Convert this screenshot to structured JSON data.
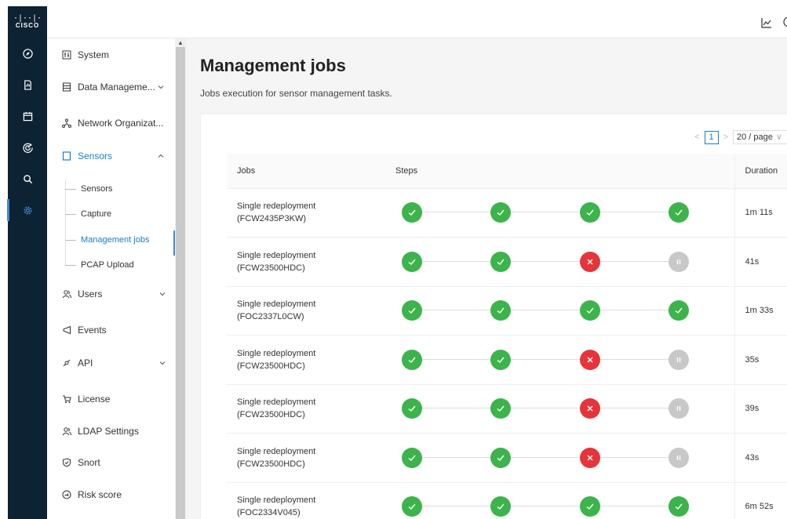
{
  "brand": {
    "logo_text": "CISCO",
    "logo_bars": "·|··|·"
  },
  "rail": [
    "compass-icon",
    "report-icon",
    "calendar-icon",
    "radar-icon",
    "search-icon",
    "gear-icon"
  ],
  "sidebar": {
    "items": [
      {
        "label": "System",
        "icon": "system-icon"
      },
      {
        "label": "Data Manageme...",
        "icon": "database-icon"
      },
      {
        "label": "Network Organizat...",
        "icon": "network-icon"
      },
      {
        "label": "Sensors",
        "icon": "sensor-icon"
      },
      {
        "label": "Users",
        "icon": "users-icon"
      },
      {
        "label": "Events",
        "icon": "events-icon"
      },
      {
        "label": "API",
        "icon": "api-icon"
      },
      {
        "label": "License",
        "icon": "license-icon"
      },
      {
        "label": "LDAP Settings",
        "icon": "ldap-icon"
      },
      {
        "label": "Snort",
        "icon": "snort-icon"
      },
      {
        "label": "Risk score",
        "icon": "risk-icon"
      }
    ],
    "sensors_sub": [
      {
        "label": "Sensors"
      },
      {
        "label": "Capture"
      },
      {
        "label": "Management jobs"
      },
      {
        "label": "PCAP Upload"
      }
    ]
  },
  "page": {
    "title": "Management jobs",
    "subtitle": "Jobs execution for sensor management tasks."
  },
  "pager": {
    "prev": "<",
    "page": "1",
    "next": ">",
    "size": "20 / page",
    "size_chevron": "∨"
  },
  "table": {
    "headers": {
      "jobs": "Jobs",
      "steps": "Steps",
      "duration": "Duration"
    },
    "rows": [
      {
        "job": "Single redeployment",
        "sensor": "(FCW2435P3KW)",
        "steps": [
          "done",
          "done",
          "done",
          "done"
        ],
        "duration": "1m 11s"
      },
      {
        "job": "Single redeployment",
        "sensor": "(FCW23500HDC)",
        "steps": [
          "done",
          "done",
          "fail",
          "pause"
        ],
        "duration": "41s"
      },
      {
        "job": "Single redeployment",
        "sensor": "(FOC2337L0CW)",
        "steps": [
          "done",
          "done",
          "done",
          "done"
        ],
        "duration": "1m 33s"
      },
      {
        "job": "Single redeployment",
        "sensor": "(FCW23500HDC)",
        "steps": [
          "done",
          "done",
          "fail",
          "pause"
        ],
        "duration": "35s"
      },
      {
        "job": "Single redeployment",
        "sensor": "(FCW23500HDC)",
        "steps": [
          "done",
          "done",
          "fail",
          "pause"
        ],
        "duration": "39s"
      },
      {
        "job": "Single redeployment",
        "sensor": "(FCW23500HDC)",
        "steps": [
          "done",
          "done",
          "fail",
          "pause"
        ],
        "duration": "43s"
      },
      {
        "job": "Single redeployment",
        "sensor": "(FOC2334V045)",
        "steps": [
          "done",
          "done",
          "done",
          "done"
        ],
        "duration": "6m 52s"
      }
    ]
  },
  "colors": {
    "accent": "#1a7fc1",
    "success": "#3cb44b",
    "error": "#e5343a",
    "pending": "#c8c8c8",
    "rail": "#0d2233"
  }
}
